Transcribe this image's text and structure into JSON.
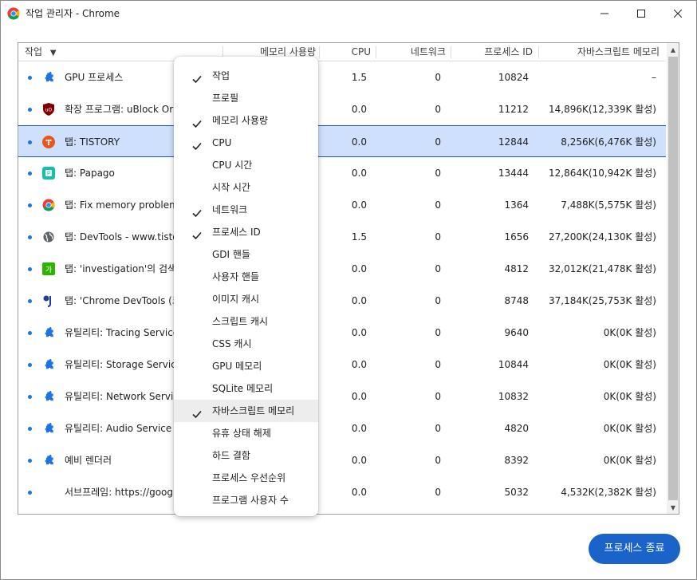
{
  "window": {
    "title": "작업 관리자 - Chrome",
    "app_icon": "chrome-logo-icon"
  },
  "colors": {
    "accent": "#1a63c9",
    "selection": "#cfe0fc",
    "status_dot": "#1a73e8"
  },
  "table": {
    "headers": {
      "task": "작업",
      "sort_indicator": "▼",
      "memory": "메모리 사용량",
      "cpu": "CPU",
      "network": "네트워크",
      "pid": "프로세스 ID",
      "js_memory": "자바스크립트 메모리"
    },
    "rows": [
      {
        "name": "GPU 프로세스",
        "icon": "puzzle-icon",
        "cpu": "1.5",
        "network": "0",
        "pid": "10824",
        "js_memory": "–"
      },
      {
        "name": "확장 프로그램: uBlock Origin",
        "icon": "ublock-icon",
        "cpu": "0.0",
        "network": "0",
        "pid": "11212",
        "js_memory": "14,896K(12,339K 활성)"
      },
      {
        "name": "탭: TISTORY",
        "icon": "tistory-icon",
        "cpu": "0.0",
        "network": "0",
        "pid": "12844",
        "js_memory": "8,256K(6,476K 활성)",
        "selected": true
      },
      {
        "name": "탭: Papago",
        "icon": "papago-icon",
        "cpu": "0.0",
        "network": "0",
        "pid": "13444",
        "js_memory": "12,864K(10,942K 활성)"
      },
      {
        "name": "탭: Fix memory problems",
        "icon": "chrome-icon",
        "cpu": "0.0",
        "network": "0",
        "pid": "1364",
        "js_memory": "7,488K(5,575K 활성)"
      },
      {
        "name": "탭: DevTools - www.tistory.com",
        "icon": "globe-icon",
        "cpu": "1.5",
        "network": "0",
        "pid": "1656",
        "js_memory": "27,200K(24,130K 활성)"
      },
      {
        "name": "탭: 'investigation'의 검색결과",
        "icon": "naver-dictionary-icon",
        "cpu": "0.0",
        "network": "0",
        "pid": "4812",
        "js_memory": "32,012K(21,478K 활성)"
      },
      {
        "name": "탭: 'Chrome DevTools (크롬",
        "icon": "blog-icon",
        "cpu": "0.0",
        "network": "0",
        "pid": "8748",
        "js_memory": "37,184K(25,753K 활성)"
      },
      {
        "name": "유틸리티: Tracing Service",
        "icon": "puzzle-icon",
        "cpu": "0.0",
        "network": "0",
        "pid": "9640",
        "js_memory": "0K(0K 활성)"
      },
      {
        "name": "유틸리티: Storage Service",
        "icon": "puzzle-icon",
        "cpu": "0.0",
        "network": "0",
        "pid": "10844",
        "js_memory": "0K(0K 활성)"
      },
      {
        "name": "유틸리티: Network Service",
        "icon": "puzzle-icon",
        "cpu": "0.0",
        "network": "0",
        "pid": "10832",
        "js_memory": "0K(0K 활성)"
      },
      {
        "name": "유틸리티: Audio Service",
        "icon": "puzzle-icon",
        "cpu": "0.0",
        "network": "0",
        "pid": "4820",
        "js_memory": "0K(0K 활성)"
      },
      {
        "name": "예비 렌더러",
        "icon": "puzzle-icon",
        "cpu": "0.0",
        "network": "0",
        "pid": "8392",
        "js_memory": "0K(0K 활성)"
      },
      {
        "name": "서브프레임: https://google.com",
        "icon": "",
        "cpu": "0.0",
        "network": "0",
        "pid": "5032",
        "js_memory": "4,532K(2,382K 활성)"
      }
    ]
  },
  "menu": {
    "items": [
      {
        "label": "작업",
        "checked": true
      },
      {
        "label": "프로필",
        "checked": false
      },
      {
        "label": "메모리 사용량",
        "checked": true
      },
      {
        "label": "CPU",
        "checked": true
      },
      {
        "label": "CPU 시간",
        "checked": false
      },
      {
        "label": "시작 시간",
        "checked": false
      },
      {
        "label": "네트워크",
        "checked": true
      },
      {
        "label": "프로세스 ID",
        "checked": true
      },
      {
        "label": "GDI 핸들",
        "checked": false
      },
      {
        "label": "사용자 핸들",
        "checked": false
      },
      {
        "label": "이미지 캐시",
        "checked": false
      },
      {
        "label": "스크립트 캐시",
        "checked": false
      },
      {
        "label": "CSS 캐시",
        "checked": false
      },
      {
        "label": "GPU 메모리",
        "checked": false
      },
      {
        "label": "SQLite 메모리",
        "checked": false
      },
      {
        "label": "자바스크립트 메모리",
        "checked": true,
        "hovered": true
      },
      {
        "label": "유휴 상태 해제",
        "checked": false
      },
      {
        "label": "하드 결함",
        "checked": false
      },
      {
        "label": "프로세스 우선순위",
        "checked": false
      },
      {
        "label": "프로그램 사용자 수",
        "checked": false
      }
    ]
  },
  "footer": {
    "end_process_label": "프로세스 종료"
  }
}
